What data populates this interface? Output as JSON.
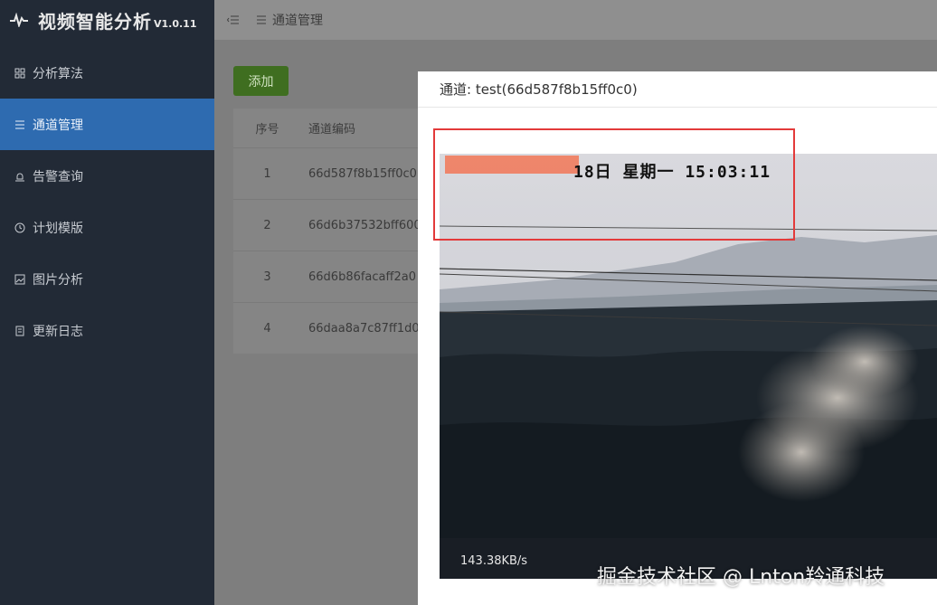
{
  "brand": {
    "title": "视频智能分析",
    "version": "V1.0.11"
  },
  "sidebar": {
    "items": [
      {
        "label": "分析算法",
        "icon": "grid-icon",
        "active": false
      },
      {
        "label": "通道管理",
        "icon": "list-icon",
        "active": true
      },
      {
        "label": "告警查询",
        "icon": "alarm-icon",
        "active": false
      },
      {
        "label": "计划模版",
        "icon": "clock-icon",
        "active": false
      },
      {
        "label": "图片分析",
        "icon": "image-icon",
        "active": false
      },
      {
        "label": "更新日志",
        "icon": "document-icon",
        "active": false
      }
    ]
  },
  "topbar": {
    "breadcrumb": "通道管理"
  },
  "main": {
    "add_label": "添加",
    "table": {
      "headers": [
        "序号",
        "通道编码"
      ],
      "rows": [
        [
          "1",
          "66d587f8b15ff0c0"
        ],
        [
          "2",
          "66d6b37532bff600"
        ],
        [
          "3",
          "66d6b86facaff2a0"
        ],
        [
          "4",
          "66daa8a7c87ff1d0"
        ]
      ]
    }
  },
  "dialog": {
    "title": "通道: test(66d587f8b15ff0c0)",
    "video": {
      "osd_text": "18日  星期一  15:03:11",
      "bitrate": "143.38KB/s"
    }
  },
  "watermark": "掘金技术社区 @ Lnton羚通科技",
  "colors": {
    "sidebar": "#222a36",
    "active": "#2e6bb0",
    "add_button": "#3f6e20",
    "highlight_box": "#e33a3a"
  }
}
